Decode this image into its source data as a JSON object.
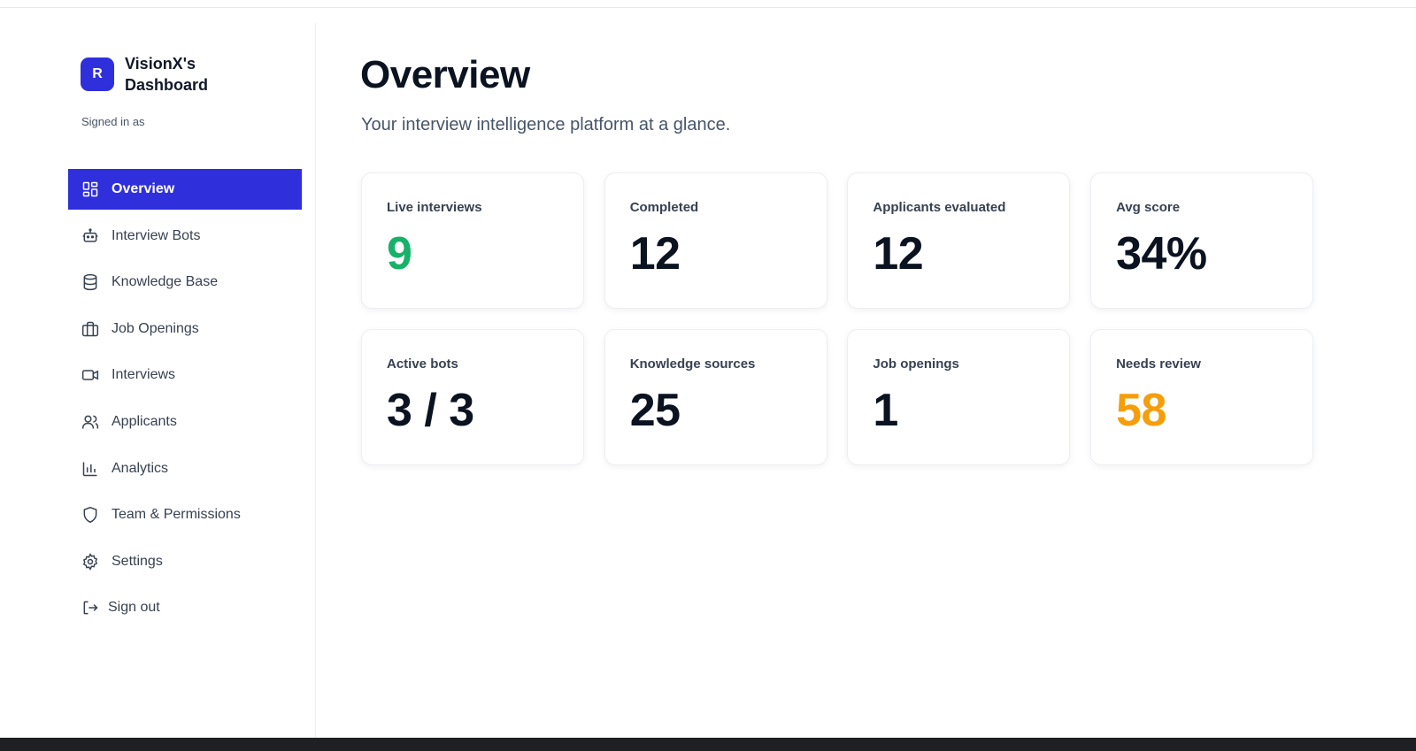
{
  "brand": {
    "badge_letter": "R",
    "title": "VisionX's Dashboard"
  },
  "account": {
    "signed_in_label": "Signed in as"
  },
  "nav": [
    {
      "label": "Overview",
      "icon": "dashboard-grid-icon",
      "active": true
    },
    {
      "label": "Interview Bots",
      "icon": "bot-icon",
      "active": false
    },
    {
      "label": "Knowledge Base",
      "icon": "database-icon",
      "active": false
    },
    {
      "label": "Job Openings",
      "icon": "briefcase-icon",
      "active": false
    },
    {
      "label": "Interviews",
      "icon": "video-camera-icon",
      "active": false
    },
    {
      "label": "Applicants",
      "icon": "users-icon",
      "active": false
    },
    {
      "label": "Analytics",
      "icon": "bar-chart-icon",
      "active": false
    },
    {
      "label": "Team & Permissions",
      "icon": "shield-icon",
      "active": false
    },
    {
      "label": "Settings",
      "icon": "gear-icon",
      "active": false
    },
    {
      "label": "Sign out",
      "icon": "logout-icon",
      "active": false
    }
  ],
  "page": {
    "title": "Overview",
    "subtitle": "Your interview intelligence platform at a glance."
  },
  "stats": [
    {
      "label": "Live interviews",
      "value": "9"
    },
    {
      "label": "Completed",
      "value": "12"
    },
    {
      "label": "Applicants evaluated",
      "value": "12"
    },
    {
      "label": "Avg score",
      "value": "34%"
    },
    {
      "label": "Active bots",
      "value": "3 / 3"
    },
    {
      "label": "Knowledge sources",
      "value": "25"
    },
    {
      "label": "Job openings",
      "value": "1"
    },
    {
      "label": "Needs review",
      "value": "58"
    }
  ],
  "colors": {
    "accent": "#2f2fdc",
    "live_value": "#17b26a",
    "review_value": "#f59e0b",
    "default_value": "#0b1220"
  }
}
